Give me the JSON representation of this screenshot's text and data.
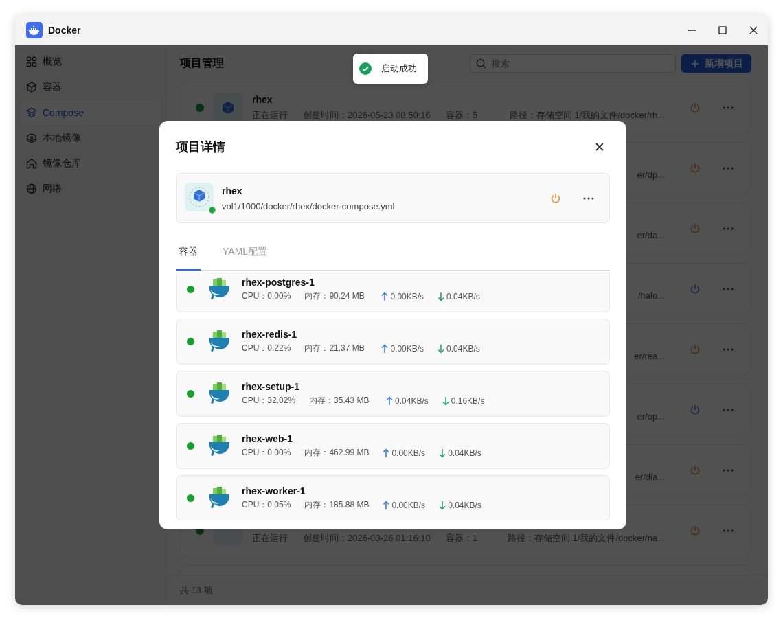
{
  "window": {
    "title": "Docker"
  },
  "sidebar": {
    "items": [
      {
        "label": "概览",
        "selected": false
      },
      {
        "label": "容器",
        "selected": false
      },
      {
        "label": "Compose",
        "selected": true
      },
      {
        "label": "本地镜像",
        "selected": false
      },
      {
        "label": "镜像仓库",
        "selected": false
      },
      {
        "label": "网络",
        "selected": false
      }
    ]
  },
  "page": {
    "title": "项目管理",
    "search": {
      "placeholder": "搜索"
    },
    "add_button": "新增项目",
    "projects": [
      {
        "name": "rhex",
        "status": "正在运行",
        "created": "创建时间：2026-05-23 08:50:16",
        "containers": "容器：5",
        "path": "路径：存储空间 1/我的文件/docker/rh...",
        "running": true
      },
      {
        "path": "er/dp...",
        "running": true
      },
      {
        "path": "er/da...",
        "running": true
      },
      {
        "path": "/halo...",
        "running": false
      },
      {
        "path": "er/rea...",
        "running": true
      },
      {
        "path": "er/op...",
        "running": false
      },
      {
        "path": "er/dia...",
        "running": true
      },
      {
        "status": "正在运行",
        "created": "创建时间：2026-03-26 01:16:10",
        "containers": "容器：1",
        "path": "路径：存储空间 1/我的文件/docker/na...",
        "running": true
      }
    ],
    "footer": "共 13 项"
  },
  "toast": {
    "text": "启动成功"
  },
  "dialog": {
    "title": "项目详情",
    "project": {
      "name": "rhex",
      "path": "vol1/1000/docker/rhex/docker-compose.yml",
      "running": true
    },
    "tabs": [
      {
        "label": "容器",
        "selected": true
      },
      {
        "label": "YAML配置",
        "selected": false
      }
    ],
    "containers": [
      {
        "name": "rhex-postgres-1",
        "running": true,
        "cpu": "CPU：0.00%",
        "memory": "内存：90.24 MB",
        "upload": "0.00KB/s",
        "download": "0.04KB/s"
      },
      {
        "name": "rhex-redis-1",
        "running": true,
        "cpu": "CPU：0.22%",
        "memory": "内存：21.37 MB",
        "upload": "0.00KB/s",
        "download": "0.04KB/s"
      },
      {
        "name": "rhex-setup-1",
        "running": true,
        "cpu": "CPU：32.02%",
        "memory": "内存：35.43 MB",
        "upload": "0.04KB/s",
        "download": "0.16KB/s"
      },
      {
        "name": "rhex-web-1",
        "running": true,
        "cpu": "CPU：0.00%",
        "memory": "内存：462.99 MB",
        "upload": "0.00KB/s",
        "download": "0.04KB/s"
      },
      {
        "name": "rhex-worker-1",
        "running": true,
        "cpu": "CPU：0.05%",
        "memory": "内存：185.88 MB",
        "upload": "0.00KB/s",
        "download": "0.04KB/s"
      }
    ]
  }
}
